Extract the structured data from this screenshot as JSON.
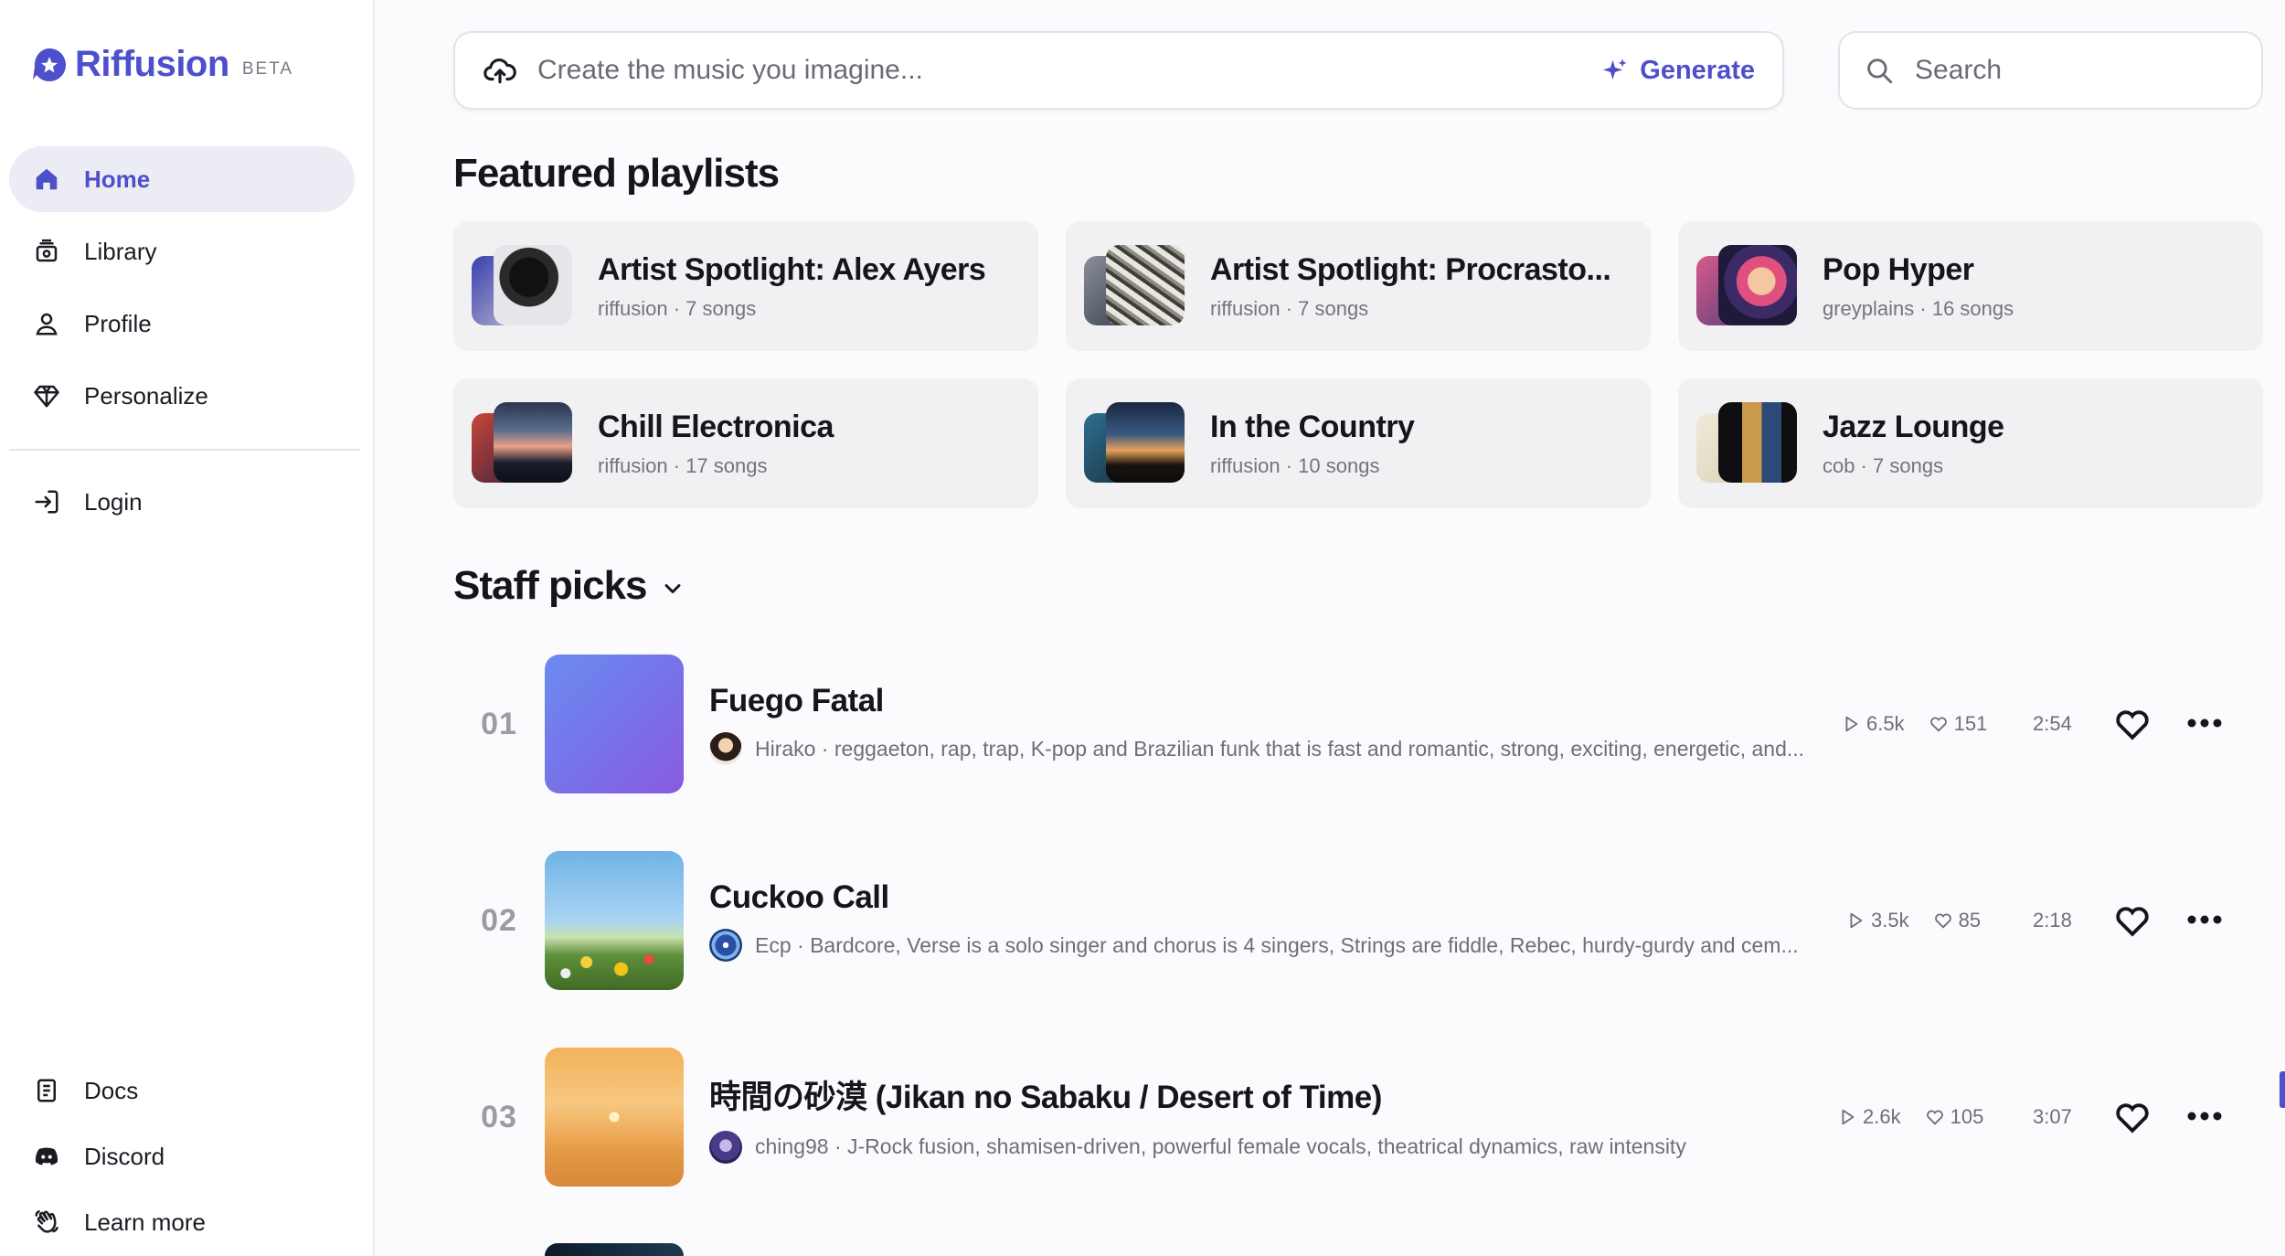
{
  "brand": {
    "name": "Riffusion",
    "badge": "BETA",
    "accent": "#4d4fcc"
  },
  "sidebar": {
    "items": [
      {
        "label": "Home",
        "icon": "home-icon",
        "active": true
      },
      {
        "label": "Library",
        "icon": "library-icon"
      },
      {
        "label": "Profile",
        "icon": "user-icon"
      },
      {
        "label": "Personalize",
        "icon": "gem-icon"
      }
    ],
    "login": {
      "label": "Login",
      "icon": "login-icon"
    },
    "bottom": [
      {
        "label": "Docs",
        "icon": "doc-icon"
      },
      {
        "label": "Discord",
        "icon": "discord-icon"
      },
      {
        "label": "Learn more",
        "icon": "hand-wave-icon"
      }
    ]
  },
  "create": {
    "placeholder": "Create the music you imagine...",
    "button": "Generate"
  },
  "search": {
    "placeholder": "Search"
  },
  "featured": {
    "heading": "Featured playlists",
    "playlists": [
      {
        "title": "Artist Spotlight: Alex Ayers",
        "sub": "riffusion · 7 songs"
      },
      {
        "title": "Artist Spotlight: Procrasto...",
        "sub": "riffusion · 7 songs"
      },
      {
        "title": "Pop Hyper",
        "sub": "greyplains · 16 songs"
      },
      {
        "title": "Chill Electronica",
        "sub": "riffusion · 17 songs"
      },
      {
        "title": "In the Country",
        "sub": "riffusion · 10 songs"
      },
      {
        "title": "Jazz Lounge",
        "sub": "cob · 7 songs"
      }
    ]
  },
  "staff": {
    "heading": "Staff picks",
    "tracks": [
      {
        "rank": "01",
        "title": "Fuego Fatal",
        "meta": "Hirako · reggaeton, rap, trap, K-pop and Brazilian funk that is fast and romantic, strong, exciting, energetic, and...",
        "plays": "6.5k",
        "likes": "151",
        "duration": "2:54"
      },
      {
        "rank": "02",
        "title": "Cuckoo Call",
        "meta": "Ecp · Bardcore, Verse is a solo singer and chorus is 4 singers, Strings are fiddle, Rebec, hurdy-gurdy and cem...",
        "plays": "3.5k",
        "likes": "85",
        "duration": "2:18"
      },
      {
        "rank": "03",
        "title": "時間の砂漠 (Jikan no Sabaku / Desert of Time)",
        "meta": "ching98 · J-Rock fusion, shamisen-driven, powerful female vocals, theatrical dynamics, raw intensity",
        "plays": "2.6k",
        "likes": "105",
        "duration": "3:07"
      }
    ]
  }
}
